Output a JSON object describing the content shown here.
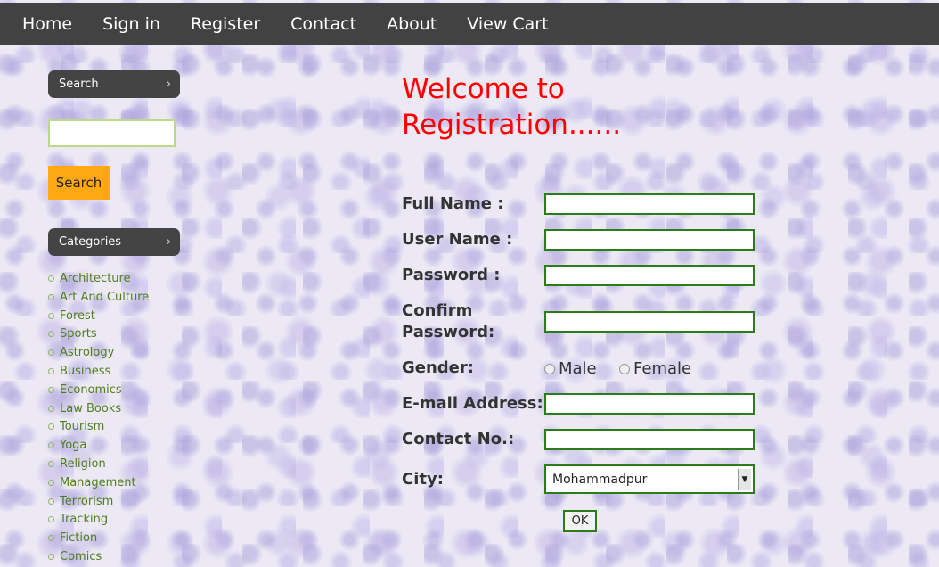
{
  "nav": {
    "items": [
      "Home",
      "Sign in",
      "Register",
      "Contact",
      "About",
      "View Cart"
    ]
  },
  "sidebar": {
    "search_header": "Search",
    "search_value": "",
    "search_button": "Search",
    "categories_header": "Categories",
    "categories": [
      "Architecture",
      "Art And Culture",
      "Forest",
      "Sports",
      "Astrology",
      "Business",
      "Economics",
      "Law Books",
      "Tourism",
      "Yoga",
      "Religion",
      "Management",
      "Terrorism",
      "Tracking",
      "Fiction",
      "Comics"
    ]
  },
  "form": {
    "title_line1": "Welcome to",
    "title_line2": "Registration......",
    "full_name_label": "Full Name :",
    "user_name_label": "User Name :",
    "password_label": "Password :",
    "confirm_password_label_1": "Confirm",
    "confirm_password_label_2": "Password:",
    "gender_label": "Gender:",
    "gender_male": "Male",
    "gender_female": "Female",
    "email_label": "E-mail Address:",
    "contact_label": "Contact No.:",
    "city_label": "City:",
    "city_selected": "Mohammadpur",
    "ok_label": "OK"
  },
  "icons": {
    "chevron": "chevron-right-icon",
    "dropdown": "dropdown-arrow-icon",
    "bullet": "bullet-icon"
  },
  "colors": {
    "nav_bg": "#424242",
    "title_red": "#ff0000",
    "category_green": "#4f7f1c",
    "search_button": "#ffa812",
    "input_border": "#2c7d1a"
  }
}
